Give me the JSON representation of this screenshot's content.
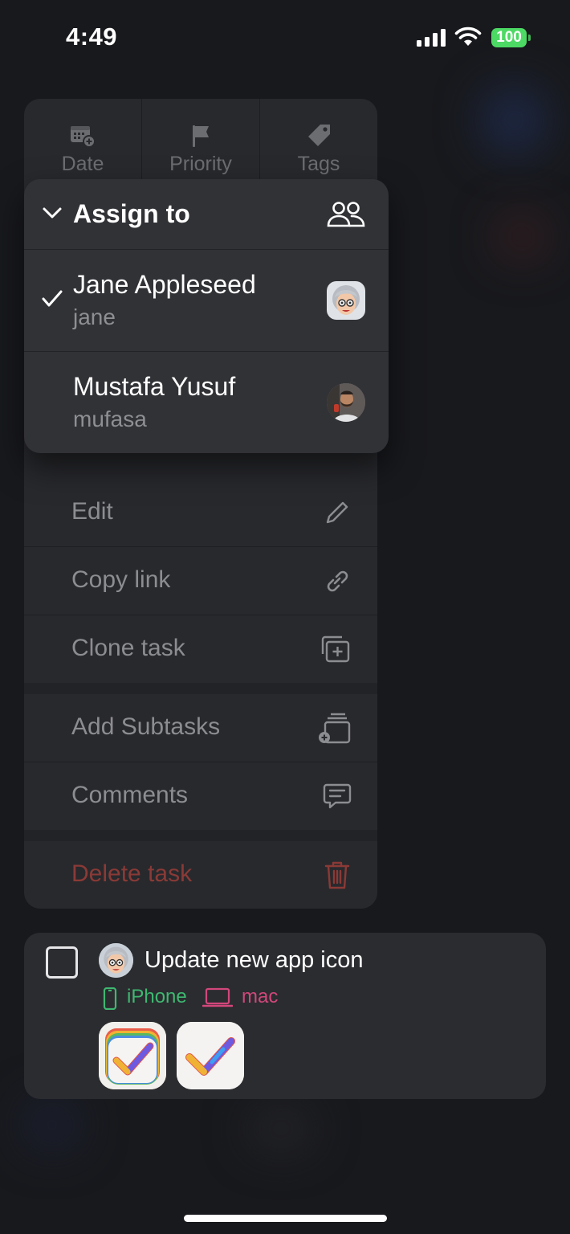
{
  "status_bar": {
    "time": "4:49",
    "battery": "100"
  },
  "toolbar": {
    "date_label": "Date",
    "priority_label": "Priority",
    "tags_label": "Tags"
  },
  "assign_menu": {
    "title": "Assign to",
    "people": [
      {
        "name": "Jane Appleseed",
        "username": "jane",
        "selected": true
      },
      {
        "name": "Mustafa Yusuf",
        "username": "mufasa",
        "selected": false
      }
    ]
  },
  "menu": {
    "edit": "Edit",
    "copy_link": "Copy link",
    "clone_task": "Clone task",
    "add_subtasks": "Add Subtasks",
    "comments": "Comments",
    "delete_task": "Delete task"
  },
  "task": {
    "title": "Update new app icon",
    "tags": [
      {
        "label": "iPhone",
        "color": "#3fb871"
      },
      {
        "label": "mac",
        "color": "#d2477b"
      }
    ]
  },
  "colors": {
    "background": "#18191d",
    "menu_bg": "#28292d",
    "popup_bg": "#313236",
    "delete": "#8a3a36",
    "battery": "#4cd964"
  }
}
